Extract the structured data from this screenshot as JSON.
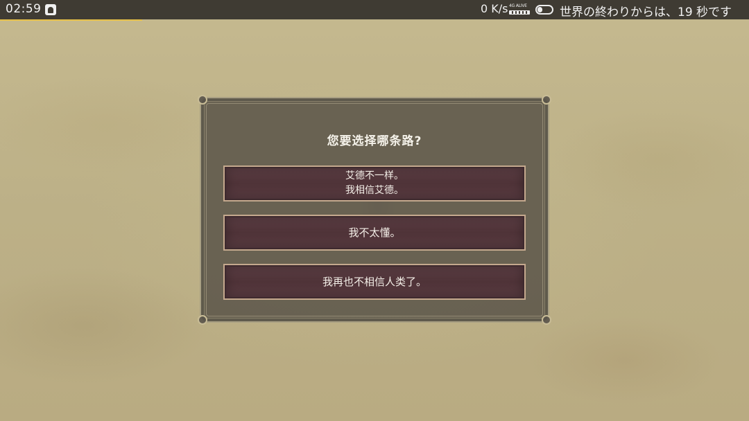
{
  "status_bar": {
    "time": "02:59",
    "net_speed": "0 K/s",
    "network_label": "4G ALIVE",
    "message": "世界の終わりからは、19 秒です"
  },
  "colors": {
    "status_bar_bg": "#3f3b33",
    "progress_accent": "#e8c24a",
    "choice_bg": "#4f3338",
    "choice_border": "#c5a98e"
  },
  "dialog": {
    "question": "您要选择哪条路?",
    "choices": [
      {
        "lines": [
          "艾德不一样。",
          "我相信艾德。"
        ]
      },
      {
        "lines": [
          "我不太懂。"
        ]
      },
      {
        "lines": [
          "我再也不相信人类了。"
        ]
      }
    ]
  }
}
